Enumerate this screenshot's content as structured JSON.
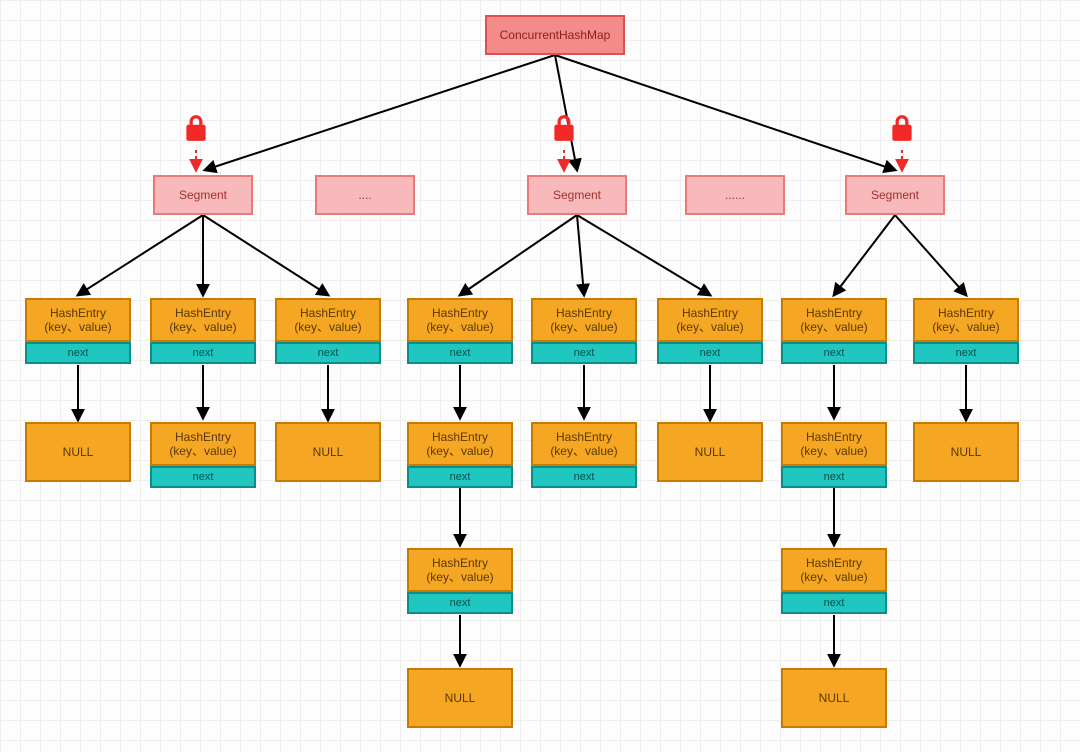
{
  "root": {
    "label": "ConcurrentHashMap"
  },
  "segments": {
    "s1": "Segment",
    "s2": "....",
    "s3": "Segment",
    "s4": "......",
    "s5": "Segment"
  },
  "entry": {
    "title": "HashEntry",
    "sub": "(key、value)",
    "next": "next"
  },
  "null_label": "NULL",
  "lock_icon": "lock-icon"
}
